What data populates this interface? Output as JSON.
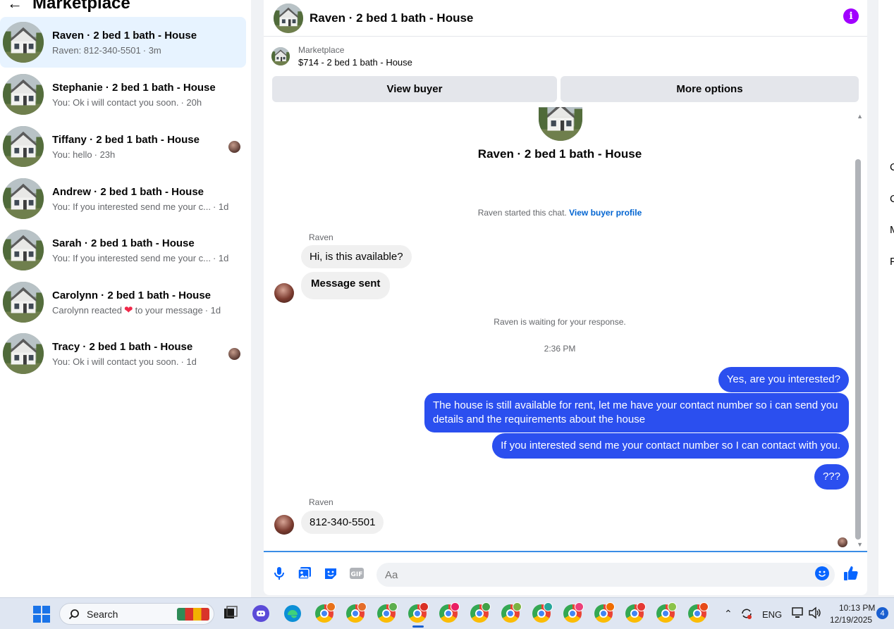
{
  "sidebar": {
    "back_icon": "arrow-left-icon",
    "title": "Marketplace",
    "conversations": [
      {
        "title": "Raven · 2 bed 1 bath - House",
        "preview": "Raven: 812-340-5501",
        "time": "· 3m",
        "active": true
      },
      {
        "title": "Stephanie · 2 bed 1 bath - House",
        "preview": "You: Ok i will contact you soon.",
        "time": "· 20h"
      },
      {
        "title": "Tiffany · 2 bed 1 bath - House",
        "preview": "You: hello",
        "time": "· 23h"
      },
      {
        "title": "Andrew · 2 bed 1 bath - House",
        "preview": "You: If you interested send me your c...",
        "time": "· 1d"
      },
      {
        "title": "Sarah · 2 bed 1 bath - House",
        "preview": "You: If you interested send me your c...",
        "time": "· 1d"
      },
      {
        "title": "Carolynn · 2 bed 1 bath - House",
        "preview_before": "Carolynn reacted",
        "preview_after": "to your message",
        "time": "· 1d"
      },
      {
        "title": "Tracy · 2 bed 1 bath - House",
        "preview": "You: Ok i will contact you soon.",
        "time": "· 1d"
      }
    ]
  },
  "chat": {
    "header_name": "Raven · 2 bed 1 bath - House",
    "info_icon": "info-icon",
    "marketplace_label": "Marketplace",
    "listing": "$714 - 2 bed 1 bath - House",
    "view_buyer": "View buyer",
    "more_options": "More options",
    "center_name": "Raven · 2 bed 1 bath - House",
    "started_text": "Raven started this chat.",
    "view_profile": "View buyer profile",
    "sender1": "Raven",
    "msg_in_1": "Hi, is this available?",
    "msg_in_2": "Message sent",
    "waiting_text": "Raven is waiting for your response.",
    "timestamp": "2:36 PM",
    "msg_out_1": "Yes, are you interested?",
    "msg_out_2": "The house is still available for rent, let me have your contact number so i can send you details and the requirements about the house",
    "msg_out_3": "If you interested send me your contact number so I can contact with you.",
    "msg_out_4": "???",
    "sender2": "Raven",
    "msg_in_3": "812-340-5501",
    "composer_placeholder": "Aa"
  },
  "right_strip": [
    "C",
    "C",
    "M",
    "P"
  ],
  "taskbar": {
    "search_label": "Search",
    "language": "ENG",
    "time": "10:13 PM",
    "date": "12/19/2025",
    "notifications": "4"
  },
  "colors": {
    "accent": "#2b4fef",
    "active_conversation": "#e7f3ff",
    "info": "#a100ff",
    "link": "#0064d1"
  }
}
